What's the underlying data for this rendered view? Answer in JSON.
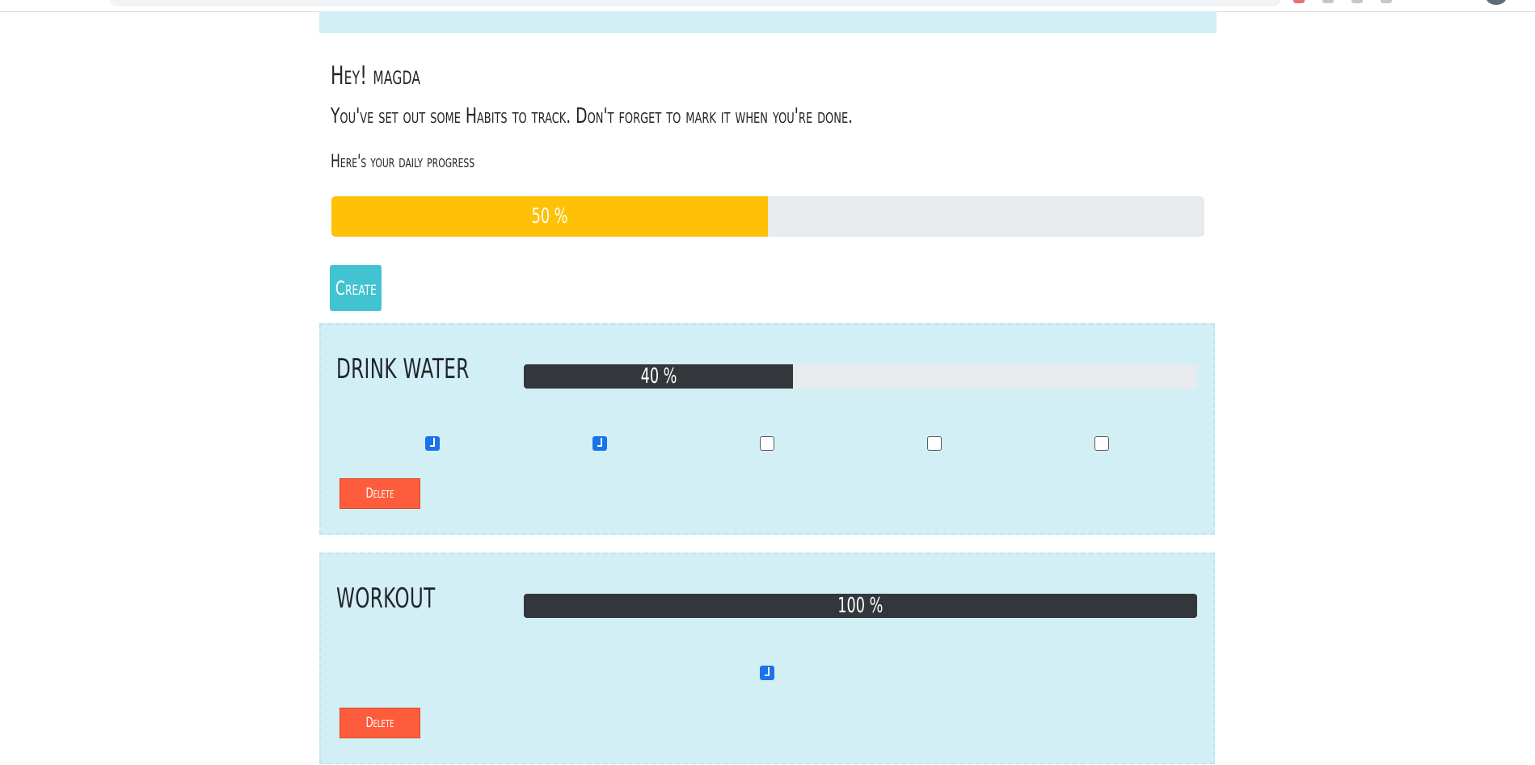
{
  "greeting": "Hey! magda",
  "subtitle": "You've set out some Habits to track. Don't forget to mark it when you're done.",
  "progress_label": "Here's your daily progress",
  "daily_progress": {
    "value": 50,
    "text": "50 %"
  },
  "create_label": "Create",
  "colors": {
    "banner": "#d3eff6",
    "daily_bar": "#fec106",
    "habit_bar": "#33363b",
    "create_button": "#42c3d2",
    "delete_button": "#fd5d3c",
    "checkbox_checked": "#1a73e8"
  },
  "habits": [
    {
      "name": "DRINK WATER",
      "progress": 40,
      "progress_text": "40 %",
      "checks": [
        true,
        true,
        false,
        false,
        false
      ],
      "delete_label": "Delete"
    },
    {
      "name": "WORKOUT",
      "progress": 100,
      "progress_text": "100 %",
      "checks": [
        true
      ],
      "delete_label": "Delete"
    }
  ]
}
